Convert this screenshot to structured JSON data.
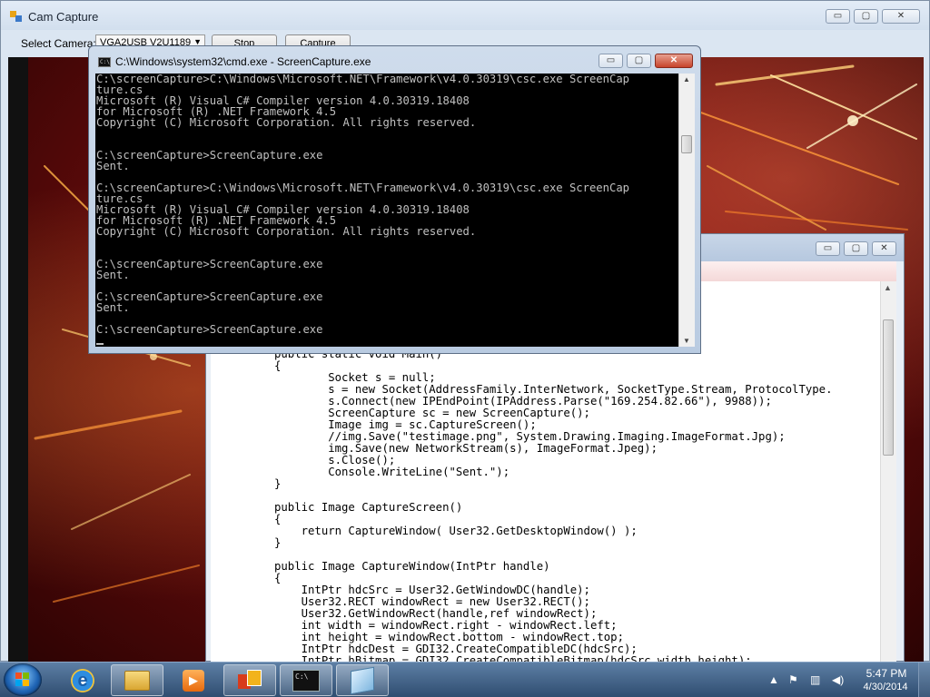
{
  "cam_capture": {
    "title": "Cam Capture",
    "select_camera_label": "Select Camera:",
    "camera_selected": "VGA2USB V2U1189",
    "stop_label": "Stop",
    "capture_label": "Capture"
  },
  "cmd": {
    "title": "C:\\Windows\\system32\\cmd.exe - ScreenCapture.exe",
    "icon_text": "C:\\",
    "lines": "C:\\screenCapture>C:\\Windows\\Microsoft.NET\\Framework\\v4.0.30319\\csc.exe ScreenCap\nture.cs\nMicrosoft (R) Visual C# Compiler version 4.0.30319.18408\nfor Microsoft (R) .NET Framework 4.5\nCopyright (C) Microsoft Corporation. All rights reserved.\n\n\nC:\\screenCapture>ScreenCapture.exe\nSent.\n\nC:\\screenCapture>C:\\Windows\\Microsoft.NET\\Framework\\v4.0.30319\\csc.exe ScreenCap\nture.cs\nMicrosoft (R) Visual C# Compiler version 4.0.30319.18408\nfor Microsoft (R) .NET Framework 4.5\nCopyright (C) Microsoft Corporation. All rights reserved.\n\n\nC:\\screenCapture>ScreenCapture.exe\nSent.\n\nC:\\screenCapture>ScreenCapture.exe\nSent.\n\nC:\\screenCapture>ScreenCapture.exe"
  },
  "editor": {
    "code": "public static void Main()\n{\n        Socket s = null;\n        s = new Socket(AddressFamily.InterNetwork, SocketType.Stream, ProtocolType.\n        s.Connect(new IPEndPoint(IPAddress.Parse(\"169.254.82.66\"), 9988));\n        ScreenCapture sc = new ScreenCapture();\n        Image img = sc.CaptureScreen();\n        //img.Save(\"testimage.png\", System.Drawing.Imaging.ImageFormat.Jpg);\n        img.Save(new NetworkStream(s), ImageFormat.Jpeg);\n        s.Close();\n        Console.WriteLine(\"Sent.\");\n}\n\npublic Image CaptureScreen()\n{\n    return CaptureWindow( User32.GetDesktopWindow() );\n}\n\npublic Image CaptureWindow(IntPtr handle)\n{\n    IntPtr hdcSrc = User32.GetWindowDC(handle);\n    User32.RECT windowRect = new User32.RECT();\n    User32.GetWindowRect(handle,ref windowRect);\n    int width = windowRect.right - windowRect.left;\n    int height = windowRect.bottom - windowRect.top;\n    IntPtr hdcDest = GDI32.CreateCompatibleDC(hdcSrc);\n    IntPtr hBitmap = GDI32.CreateCompatibleBitmap(hdcSrc,width,height);"
  },
  "window_buttons": {
    "minimize": "▭",
    "maximize": "▢",
    "close": "✕"
  },
  "taskbar": {
    "items": [
      "start",
      "internet-explorer",
      "windows-explorer",
      "media-player",
      "office",
      "cmd",
      "notepad"
    ],
    "clock_time": "5:47 PM",
    "clock_date": "4/30/2014",
    "tray_icons": [
      "show-hidden-icons",
      "action-center-flag",
      "network",
      "volume"
    ]
  },
  "colors": {
    "console_bg": "#000000",
    "console_fg": "#c0c0c0",
    "close_red": "#c7432b",
    "taskbar_blue": "#2f4d70"
  }
}
